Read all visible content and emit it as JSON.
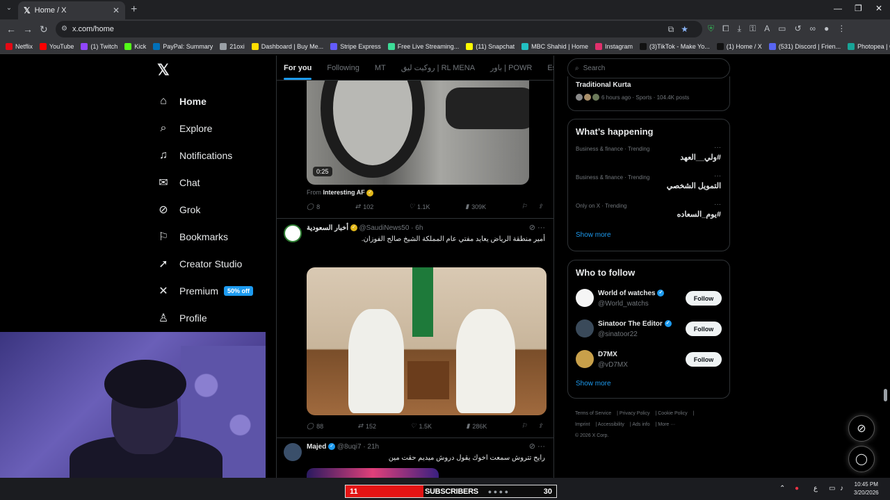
{
  "browser": {
    "tab_title": "Home / X",
    "url": "x.com/home",
    "bookmarks": [
      {
        "label": "Netflix",
        "color": "#e50914"
      },
      {
        "label": "YouTube",
        "color": "#ff0000"
      },
      {
        "label": "(1) Twitch",
        "color": "#9146ff"
      },
      {
        "label": "Kick",
        "color": "#53fc18"
      },
      {
        "label": "PayPal: Summary",
        "color": "#0070ba"
      },
      {
        "label": "21oxi",
        "color": "#9aa0a6"
      },
      {
        "label": "Dashboard | Buy Me...",
        "color": "#ffdd00"
      },
      {
        "label": "Stripe Express",
        "color": "#635bff"
      },
      {
        "label": "Free Live Streaming...",
        "color": "#3ddc97"
      },
      {
        "label": "(11) Snapchat",
        "color": "#fffc00"
      },
      {
        "label": "MBC Shahid | Home",
        "color": "#22c1c3"
      },
      {
        "label": "Instagram",
        "color": "#e1306c"
      },
      {
        "label": "(3)TikTok - Make Yo...",
        "color": "#111111"
      },
      {
        "label": "(1) Home / X",
        "color": "#111111"
      },
      {
        "label": "(531) Discord | Frien...",
        "color": "#5865f2"
      },
      {
        "label": "Photopea | Online P...",
        "color": "#18a497"
      }
    ]
  },
  "sidebar": {
    "items": [
      {
        "label": "Home",
        "icon": "home-icon",
        "glyph": "⌂"
      },
      {
        "label": "Explore",
        "icon": "search-icon",
        "glyph": "⌕"
      },
      {
        "label": "Notifications",
        "icon": "bell-icon",
        "glyph": "♫"
      },
      {
        "label": "Chat",
        "icon": "mail-icon",
        "glyph": "✉"
      },
      {
        "label": "Grok",
        "icon": "grok-icon",
        "glyph": "⊘"
      },
      {
        "label": "Bookmarks",
        "icon": "bookmark-icon",
        "glyph": "⚐"
      },
      {
        "label": "Creator Studio",
        "icon": "rocket-icon",
        "glyph": "➚"
      },
      {
        "label": "Premium",
        "icon": "x-icon",
        "glyph": "✕"
      },
      {
        "label": "Profile",
        "icon": "person-icon",
        "glyph": "♙"
      }
    ],
    "premium_badge": "50% off"
  },
  "feed": {
    "tabs": [
      "For you",
      "Following",
      "MT",
      "روكيت ليق | RL MENA",
      "باور | POWR",
      "Espor"
    ],
    "tweet1": {
      "duration": "0:25",
      "from_label": "From",
      "from_name": "Interesting AF",
      "replies": "8",
      "retweets": "102",
      "likes": "1.1K",
      "views": "309K"
    },
    "tweet2": {
      "name": "أخبار السعودية",
      "handle": "@SaudiNews50",
      "time": "· 6h",
      "text": "أمير منطقة الرياض يعايد مفتي عام المملكة الشيخ صالح الفوزان.",
      "replies": "88",
      "retweets": "152",
      "likes": "1.5K",
      "views": "286K"
    },
    "tweet3": {
      "name": "Majed",
      "handle": "@8uqi7",
      "time": "· 21h",
      "text": "رايح تتروش سمعت اخوك يقول دروش ميديم حقت مين"
    }
  },
  "right": {
    "search_placeholder": "Search",
    "top_trend": {
      "title": "Traditional Kurta",
      "meta": "6 hours ago · Sports · 104.4K posts"
    },
    "happening": {
      "title": "What’s happening",
      "trends": [
        {
          "meta": "Business & finance · Trending",
          "name": "#ولي__العهد"
        },
        {
          "meta": "Business & finance · Trending",
          "name": "التمويل الشخصي"
        },
        {
          "meta": "Only on X · Trending",
          "name": "#يوم_السعاده"
        }
      ],
      "show_more": "Show more"
    },
    "who_to_follow": {
      "title": "Who to follow",
      "users": [
        {
          "name": "World of watches",
          "handle": "@World_watchs",
          "button": "Follow",
          "avatar_color": "#f5f5f5"
        },
        {
          "name": "Sinatoor The Editor",
          "handle": "@sinatoor22",
          "button": "Follow",
          "avatar_color": "#3a4a5a"
        },
        {
          "name": "D7MX",
          "handle": "@vD7MX",
          "button": "Follow",
          "avatar_color": "#c8a04a"
        }
      ],
      "show_more": "Show more"
    },
    "footer": [
      "Terms of Service",
      "Privacy Policy",
      "Cookie Policy",
      "Imprint",
      "Accessibility",
      "Ads info",
      "More ···",
      "© 2026 X Corp."
    ]
  },
  "overlay": {
    "sub_count_left": "11",
    "sub_label": "SUBSCRIBERS",
    "sub_count_right": "30"
  },
  "taskbar": {
    "time": "10:45 PM",
    "date": "3/20/2026",
    "lang": "ع"
  }
}
